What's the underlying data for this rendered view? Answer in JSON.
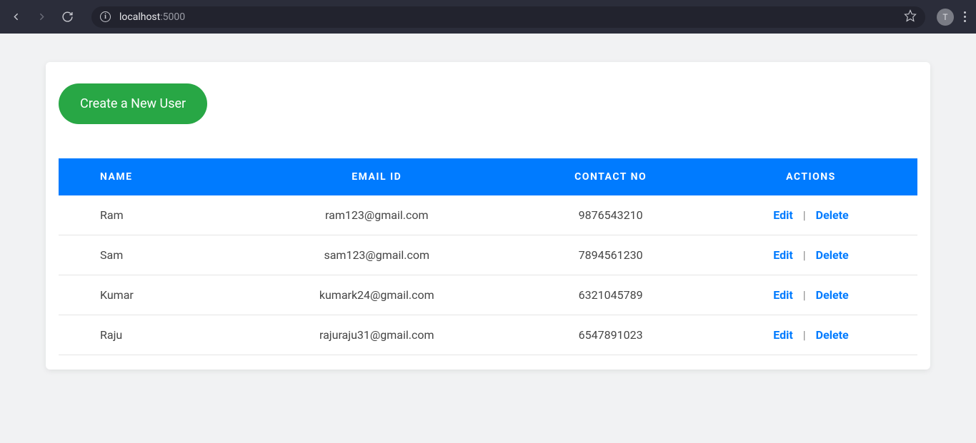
{
  "browser": {
    "url_host": "localhost",
    "url_port": ":5000",
    "profile_initial": "T"
  },
  "page": {
    "create_user_label": "Create a New User",
    "table": {
      "headers": {
        "name": "NAME",
        "email": "EMAIL ID",
        "contact": "CONTACT NO",
        "actions": "ACTIONS"
      },
      "action_labels": {
        "edit": "Edit",
        "delete": "Delete",
        "sep": "|"
      },
      "rows": [
        {
          "name": "Ram",
          "email": "ram123@gmail.com",
          "contact": "9876543210"
        },
        {
          "name": "Sam",
          "email": "sam123@gmail.com",
          "contact": "7894561230"
        },
        {
          "name": "Kumar",
          "email": "kumark24@gmail.com",
          "contact": "6321045789"
        },
        {
          "name": "Raju",
          "email": "rajuraju31@gmail.com",
          "contact": "6547891023"
        }
      ]
    }
  }
}
